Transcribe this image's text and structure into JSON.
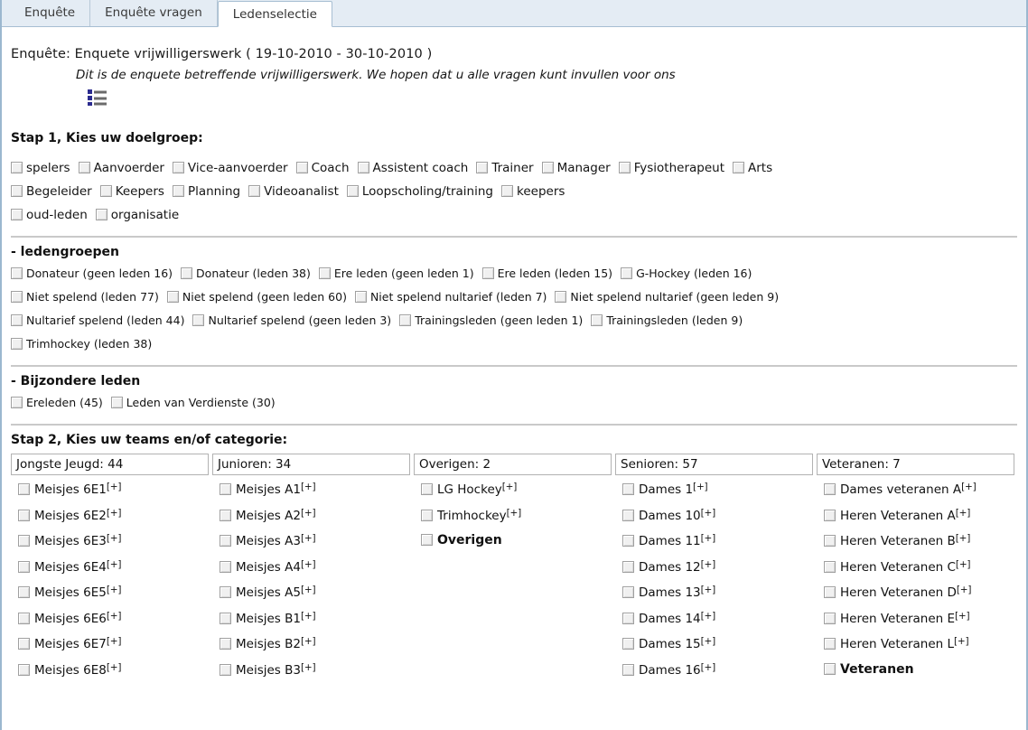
{
  "tabs": [
    {
      "label": "Enquête",
      "active": false
    },
    {
      "label": "Enquête vragen",
      "active": false
    },
    {
      "label": "Ledenselectie",
      "active": true
    }
  ],
  "survey": {
    "title": "Enquête: Enquete vrijwilligerswerk ( 19-10-2010  -  30-10-2010 )",
    "description": "Dit is de enquete betreffende vrijwilligerswerk. We hopen dat u alle vragen kunt invullen voor ons",
    "icon": "list-icon"
  },
  "step1": {
    "title": "Stap 1, Kies uw doelgroep:",
    "rows": [
      [
        "spelers",
        "Aanvoerder",
        "Vice-aanvoerder",
        "Coach",
        "Assistent coach",
        "Trainer",
        "Manager",
        "Fysiotherapeut",
        "Arts"
      ],
      [
        "Begeleider",
        "Keepers",
        "Planning",
        "Videoanalist",
        "Loopscholing/training",
        "keepers"
      ],
      [
        "oud-leden",
        "organisatie"
      ]
    ]
  },
  "ledengroepen": {
    "title": "- ledengroepen",
    "rows": [
      [
        "Donateur (geen leden 16)",
        "Donateur (leden 38)",
        "Ere leden (geen leden 1)",
        "Ere leden (leden 15)",
        "G-Hockey (leden 16)"
      ],
      [
        "Niet spelend (leden 77)",
        "Niet spelend (geen leden 60)",
        "Niet spelend nultarief (leden 7)",
        "Niet spelend nultarief (geen leden 9)"
      ],
      [
        "Nultarief spelend (leden 44)",
        "Nultarief spelend (geen leden 3)",
        "Trainingsleden (geen leden 1)",
        "Trainingsleden (leden 9)"
      ],
      [
        "Trimhockey (leden 38)"
      ]
    ]
  },
  "bijzondere": {
    "title": "- Bijzondere leden",
    "rows": [
      [
        "Ereleden (45)",
        "Leden van Verdienste (30)"
      ]
    ]
  },
  "step2": {
    "title": "Stap 2, Kies uw teams en/of categorie:",
    "columns": [
      {
        "header": "Jongste Jeugd: 44",
        "items": [
          {
            "label": "Meisjes 6E1",
            "sup": "[+]",
            "bold": false
          },
          {
            "label": "Meisjes 6E2",
            "sup": "[+]",
            "bold": false
          },
          {
            "label": "Meisjes 6E3",
            "sup": "[+]",
            "bold": false
          },
          {
            "label": "Meisjes 6E4",
            "sup": "[+]",
            "bold": false
          },
          {
            "label": "Meisjes 6E5",
            "sup": "[+]",
            "bold": false
          },
          {
            "label": "Meisjes 6E6",
            "sup": "[+]",
            "bold": false
          },
          {
            "label": "Meisjes 6E7",
            "sup": "[+]",
            "bold": false
          },
          {
            "label": "Meisjes 6E8",
            "sup": "[+]",
            "bold": false
          }
        ]
      },
      {
        "header": "Junioren: 34",
        "items": [
          {
            "label": "Meisjes A1",
            "sup": "[+]",
            "bold": false
          },
          {
            "label": "Meisjes A2",
            "sup": "[+]",
            "bold": false
          },
          {
            "label": "Meisjes A3",
            "sup": "[+]",
            "bold": false
          },
          {
            "label": "Meisjes A4",
            "sup": "[+]",
            "bold": false
          },
          {
            "label": "Meisjes A5",
            "sup": "[+]",
            "bold": false
          },
          {
            "label": "Meisjes B1",
            "sup": "[+]",
            "bold": false
          },
          {
            "label": "Meisjes B2",
            "sup": "[+]",
            "bold": false
          },
          {
            "label": "Meisjes B3",
            "sup": "[+]",
            "bold": false
          }
        ]
      },
      {
        "header": "Overigen: 2",
        "items": [
          {
            "label": "LG Hockey",
            "sup": "[+]",
            "bold": false
          },
          {
            "label": "Trimhockey",
            "sup": "[+]",
            "bold": false
          },
          {
            "label": "Overigen",
            "sup": "",
            "bold": true
          }
        ]
      },
      {
        "header": "Senioren: 57",
        "items": [
          {
            "label": "Dames 1",
            "sup": "[+]",
            "bold": false
          },
          {
            "label": "Dames 10",
            "sup": "[+]",
            "bold": false
          },
          {
            "label": "Dames 11",
            "sup": "[+]",
            "bold": false
          },
          {
            "label": "Dames 12",
            "sup": "[+]",
            "bold": false
          },
          {
            "label": "Dames 13",
            "sup": "[+]",
            "bold": false
          },
          {
            "label": "Dames 14",
            "sup": "[+]",
            "bold": false
          },
          {
            "label": "Dames 15",
            "sup": "[+]",
            "bold": false
          },
          {
            "label": "Dames 16",
            "sup": "[+]",
            "bold": false
          }
        ]
      },
      {
        "header": "Veteranen: 7",
        "items": [
          {
            "label": "Dames veteranen A",
            "sup": "[+]",
            "bold": false
          },
          {
            "label": "Heren Veteranen A",
            "sup": "[+]",
            "bold": false
          },
          {
            "label": "Heren Veteranen B",
            "sup": "[+]",
            "bold": false
          },
          {
            "label": "Heren Veteranen C",
            "sup": "[+]",
            "bold": false
          },
          {
            "label": "Heren Veteranen D",
            "sup": "[+]",
            "bold": false
          },
          {
            "label": "Heren Veteranen E",
            "sup": "[+]",
            "bold": false
          },
          {
            "label": "Heren Veteranen L",
            "sup": "[+]",
            "bold": false
          },
          {
            "label": "Veteranen",
            "sup": "",
            "bold": true
          }
        ]
      }
    ]
  },
  "colors": {
    "tabstrip_bg": "#e4ecf4",
    "border": "#9bb7cf",
    "divider": "#c9c9c9",
    "icon_blue": "#2b2b8f"
  }
}
